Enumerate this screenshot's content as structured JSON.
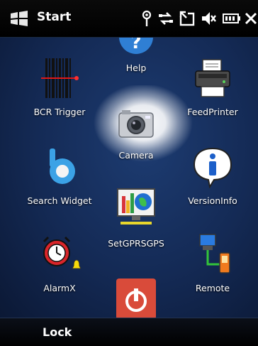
{
  "statusbar": {
    "start_label": "Start",
    "icons": [
      "antenna-icon",
      "sync-arrows-icon",
      "connection-icon",
      "volume-muted-icon",
      "battery-icon",
      "close-icon"
    ]
  },
  "tiles": [
    {
      "name": "help",
      "label": "Help",
      "icon": "help-icon"
    },
    {
      "name": "bcr-trigger",
      "label": "BCR Trigger",
      "icon": "barcode-icon"
    },
    {
      "name": "feedprinter",
      "label": "FeedPrinter",
      "icon": "printer-icon"
    },
    {
      "name": "camera",
      "label": "Camera",
      "icon": "camera-icon",
      "selected": true
    },
    {
      "name": "search-widget",
      "label": "Search Widget",
      "icon": "bing-icon"
    },
    {
      "name": "versioninfo",
      "label": "VersionInfo",
      "icon": "info-icon"
    },
    {
      "name": "setgprsgps",
      "label": "SetGPRSGPS",
      "icon": "monitor-globe-icon"
    },
    {
      "name": "alarmx",
      "label": "AlarmX",
      "icon": "alarm-clock-icon"
    },
    {
      "name": "power",
      "label": "",
      "icon": "power-icon"
    },
    {
      "name": "remote",
      "label": "Remote",
      "icon": "remote-icon"
    }
  ],
  "softkeys": {
    "left": "Lock"
  },
  "colors": {
    "background": "#142a55",
    "statusbar": "#000000",
    "accent": "#2f7fd4"
  }
}
